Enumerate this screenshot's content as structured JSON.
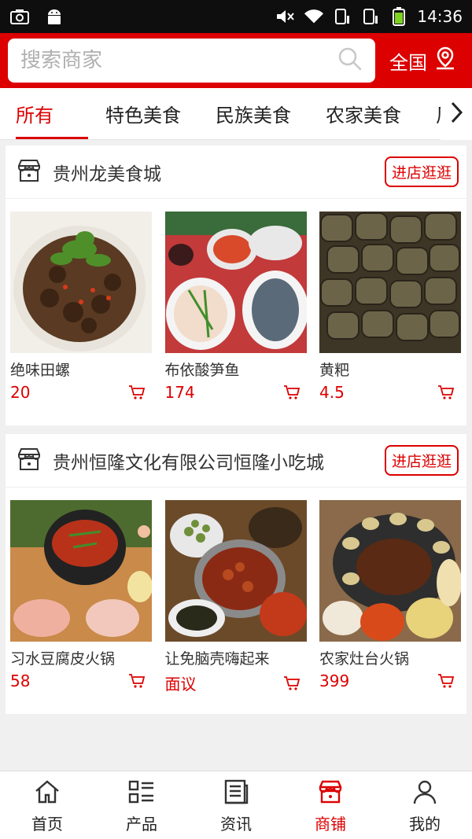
{
  "status_bar": {
    "time": "14:36"
  },
  "search": {
    "placeholder": "搜索商家",
    "region": "全国"
  },
  "tabs": [
    "所有",
    "特色美食",
    "民族美食",
    "农家美食",
    "风味"
  ],
  "stores": [
    {
      "name": "贵州龙美食城",
      "button": "进店逛逛",
      "products": [
        {
          "name": "绝味田螺",
          "price": "20"
        },
        {
          "name": "布依酸笋鱼",
          "price": "174"
        },
        {
          "name": "黄粑",
          "price": "4.5"
        }
      ]
    },
    {
      "name": "贵州恒隆文化有限公司恒隆小吃城",
      "button": "进店逛逛",
      "products": [
        {
          "name": "习水豆腐皮火锅",
          "price": "58"
        },
        {
          "name": "让免脑壳嗨起来",
          "price": "面议"
        },
        {
          "name": "农家灶台火锅",
          "price": "399"
        }
      ]
    }
  ],
  "bottom_nav": [
    {
      "label": "首页",
      "icon": "home-icon"
    },
    {
      "label": "产品",
      "icon": "product-list-icon"
    },
    {
      "label": "资讯",
      "icon": "news-icon"
    },
    {
      "label": "商铺",
      "icon": "shop-icon",
      "active": true
    },
    {
      "label": "我的",
      "icon": "user-icon"
    }
  ],
  "colors": {
    "accent": "#dc0000",
    "status_bar": "#0e0e0e",
    "background": "#f0f0f0"
  }
}
